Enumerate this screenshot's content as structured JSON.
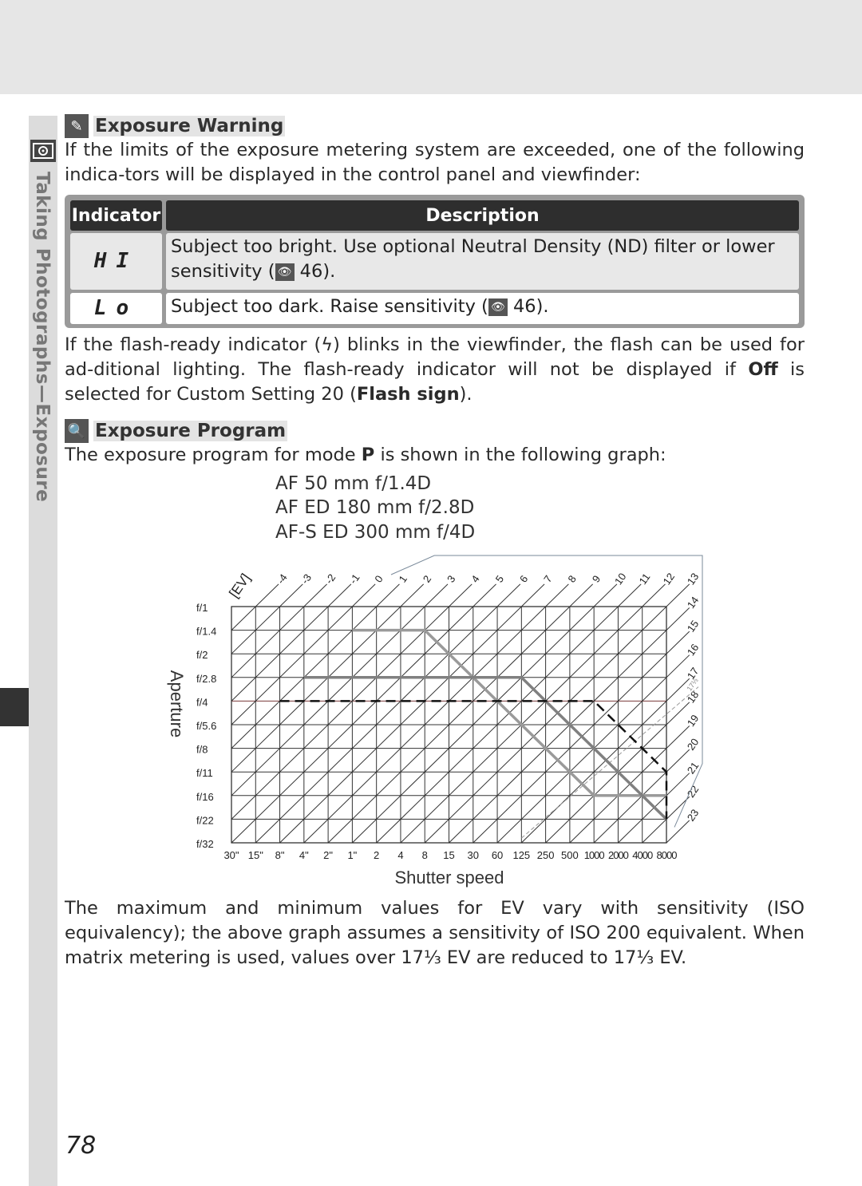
{
  "side_tab": {
    "label": "Taking Photographs—Exposure",
    "icon": "metering-icon"
  },
  "section1": {
    "title": "Exposure Warning",
    "icon": "note-pencil-icon",
    "intro": "If the limits of the exposure metering system are exceeded, one of the following indica-tors will be displayed in the control panel and viewfinder:"
  },
  "table": {
    "headers": [
      "Indicator",
      "Description"
    ],
    "rows": [
      {
        "indicator": "HI",
        "desc": "Subject too bright.  Use optional Neutral Density (ND) filter or lower sensitivity (",
        "ref": "46",
        "tail": ")."
      },
      {
        "indicator": "Lo",
        "desc": "Subject too dark.  Raise sensitivity (",
        "ref": "46",
        "tail": ")."
      }
    ]
  },
  "flash_para": {
    "a": "If the flash-ready indicator (",
    "b": ") blinks in the viewfinder, the flash can be used for ad-ditional lighting.  The flash-ready indicator will not be displayed if ",
    "off": "Off",
    "c": " is selected for Custom Setting 20 (",
    "flash_sign": "Flash sign",
    "d": ")."
  },
  "section2": {
    "title": "Exposure Program",
    "icon": "magnifier-icon",
    "intro_a": "The exposure program for mode ",
    "mode": "P",
    "intro_b": " is shown in the following graph:"
  },
  "lenses": [
    "AF 50 mm f/1.4D",
    "AF ED 180 mm f/2.8D",
    "AF-S ED 300 mm f/4D"
  ],
  "chart_data": {
    "type": "line",
    "xlabel": "Shutter speed",
    "ylabel": "Aperture",
    "ev_label": "[EV]",
    "shutter_ticks": [
      "30\"",
      "15\"",
      "8\"",
      "4\"",
      "2\"",
      "1\"",
      "2",
      "4",
      "8",
      "15",
      "30",
      "60",
      "125",
      "250",
      "500",
      "1000",
      "2000",
      "4000",
      "8000"
    ],
    "aperture_ticks": [
      "f/1",
      "f/1.4",
      "f/2",
      "f/2.8",
      "f/4",
      "f/5.6",
      "f/8",
      "f/11",
      "f/16",
      "f/22",
      "f/32"
    ],
    "ev_ticks": [
      -4,
      -3,
      -2,
      -1,
      0,
      1,
      2,
      3,
      4,
      5,
      6,
      7,
      8,
      9,
      10,
      11,
      12,
      13,
      14,
      15,
      16,
      17,
      18,
      19,
      20,
      21,
      22,
      23
    ],
    "ev_limit_label": "17⅓",
    "grid": true,
    "series": [
      {
        "lens": "AF 50 mm f/1.4D",
        "style": "solid-light-gray",
        "color": "#9a9a9a",
        "points": [
          [
            "1\"",
            "f/1.4"
          ],
          [
            "8",
            "f/1.4"
          ],
          [
            "1000",
            "f/16"
          ],
          [
            "8000",
            "f/16"
          ]
        ]
      },
      {
        "lens": "AF ED 180 mm f/2.8D",
        "style": "solid-gray",
        "color": "#808080",
        "points": [
          [
            "4\"",
            "f/2.8"
          ],
          [
            "125",
            "f/2.8"
          ],
          [
            "8000",
            "f/22"
          ]
        ]
      },
      {
        "lens": "AF-S ED 300 mm f/4D",
        "style": "dashed-black",
        "color": "#111111",
        "points": [
          [
            "8\"",
            "f/4"
          ],
          [
            "1000",
            "f/4"
          ],
          [
            "8000",
            "f/11"
          ],
          [
            "8000",
            "f/22"
          ]
        ]
      }
    ]
  },
  "closing": "The maximum and minimum values for EV vary with sensitivity (ISO equivalency); the above graph assumes a sensitivity of ISO 200 equivalent.  When matrix metering is used, values over 17⅓ EV are reduced to 17⅓ EV.",
  "page_number": "78"
}
